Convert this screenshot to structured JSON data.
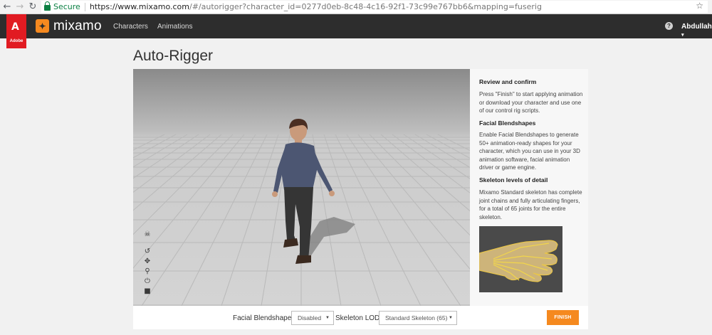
{
  "browser": {
    "secure_label": "Secure",
    "url_host": "https://www.mixamo.com",
    "url_path": "/#/autorigger?character_id=0277d0eb-8c48-4c16-92f1-73c99e767bb6&mapping=fuserig"
  },
  "header": {
    "adobe_label": "Adobe",
    "brand": "mixamo",
    "nav": [
      "Characters",
      "Animations"
    ],
    "user": "Abdullah"
  },
  "page": {
    "title": "Auto-Rigger"
  },
  "panel": {
    "sections": [
      {
        "heading": "Review and confirm",
        "text": "Press \"Finish\" to start applying animation or download your character and use one of our control rig scripts."
      },
      {
        "heading": "Facial Blendshapes",
        "text": "Enable Facial Blendshapes to generate 50+ animation-ready shapes for your character, which you can use in your 3D animation software, facial animation driver or game engine."
      },
      {
        "heading": "Skeleton levels of detail",
        "text": "Mixamo Standard skeleton has complete joint chains and fully articulating fingers, for a total of 65 joints for the entire skeleton."
      }
    ]
  },
  "footer": {
    "blendshapes_label": "Facial Blendshapes",
    "blendshapes_value": "Disabled",
    "lod_label": "Skeleton LOD",
    "lod_value": "Standard Skeleton (65)",
    "finish_label": "FINISH"
  },
  "colors": {
    "accent": "#f5891f",
    "adobe_red": "#e11b22",
    "header_bg": "#2d2d2d"
  },
  "viewport_tools": [
    "skull-icon",
    "rotate-icon",
    "move-icon",
    "zoom-icon",
    "power-icon",
    "camera-icon"
  ]
}
